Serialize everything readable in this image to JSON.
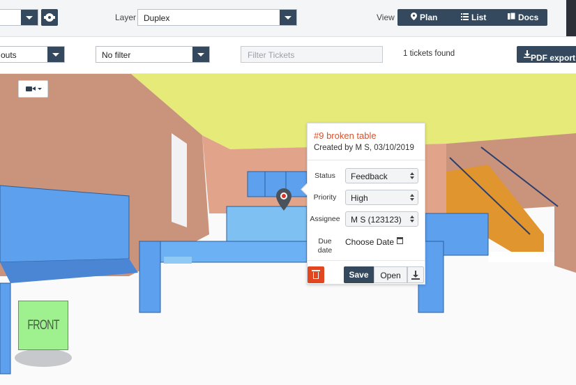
{
  "toolbar": {
    "layer_label": "Layer",
    "layer_value": "Duplex",
    "view_label": "View",
    "view_options": [
      {
        "label": "Plan",
        "icon": "map-marker-icon"
      },
      {
        "label": "List",
        "icon": "list-icon"
      },
      {
        "label": "Docs",
        "icon": "documents-icon"
      }
    ]
  },
  "filters": {
    "group_value": "outs",
    "filter_value": "No filter",
    "search_placeholder": "Filter Tickets",
    "ticket_count": "1 tickets found",
    "pdf_export_label": "PDF export"
  },
  "viewer": {
    "nav_cube_label": "FRONT"
  },
  "ticket": {
    "title": "#9 broken table",
    "created": "Created by M S, 03/10/2019",
    "fields": {
      "status_label": "Status",
      "status_value": "Feedback",
      "priority_label": "Priority",
      "priority_value": "High",
      "assignee_label": "Assignee",
      "assignee_value": "M S (123123)",
      "due_label_line1": "Due",
      "due_label_line2": "date",
      "due_value": "Choose Date"
    },
    "actions": {
      "save_label": "Save",
      "open_label": "Open"
    }
  },
  "colors": {
    "toolbar_button": "#34495e",
    "delete_button": "#e0461f",
    "ticket_title": "#d35432",
    "nav_cube": "#9ff08f",
    "ceiling": "#e6ea78",
    "wall": "#c9937c",
    "furniture": "#5da0ee"
  }
}
